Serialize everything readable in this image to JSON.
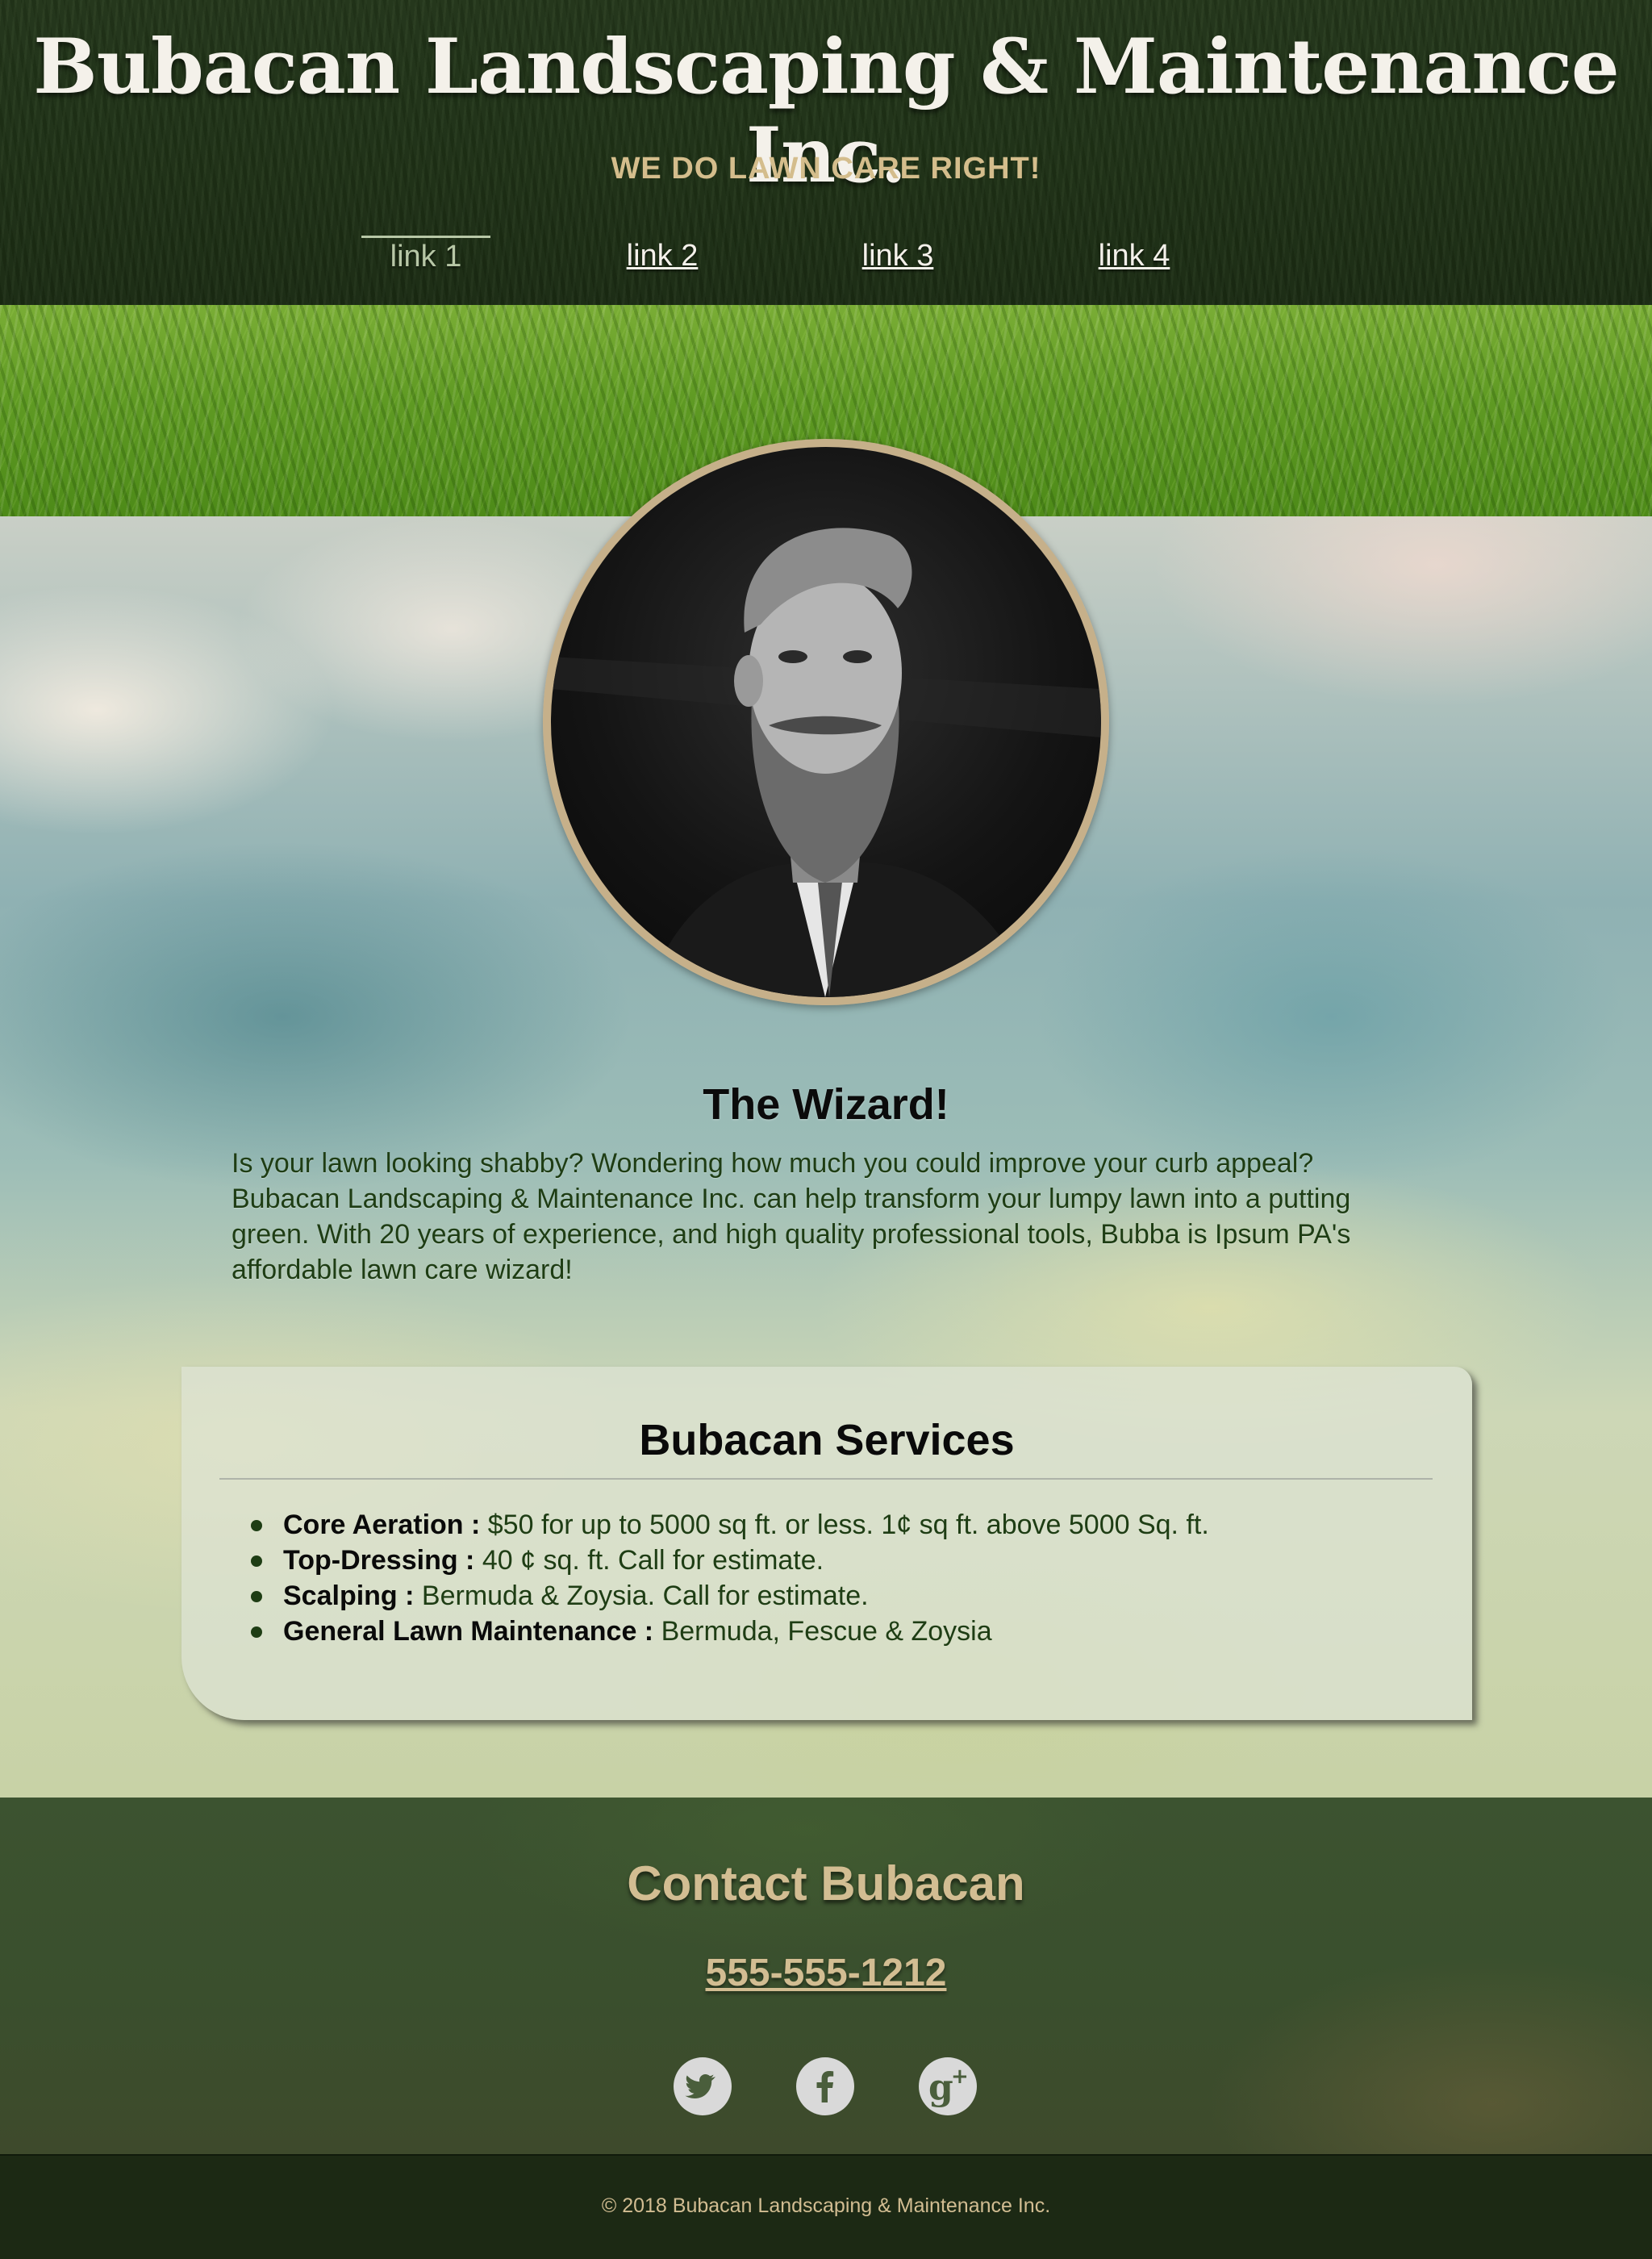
{
  "header": {
    "title": "Bubacan Landscaping & Maintenance Inc.",
    "tagline": "WE DO LAWN CARE RIGHT!",
    "nav": [
      {
        "label": "link 1",
        "active": true
      },
      {
        "label": "link 2",
        "active": false
      },
      {
        "label": "link 3",
        "active": false
      },
      {
        "label": "link 4",
        "active": false
      }
    ]
  },
  "wizard": {
    "heading": "The Wizard!",
    "text": "Is your lawn looking shabby? Wondering how much you could improve your curb appeal? Bubacan Landscaping & Maintenance Inc. can help transform your lumpy lawn into a putting green. With 20 years of experience, and high quality professional tools, Bubba is Ipsum PA's affordable lawn care wizard!"
  },
  "services": {
    "heading": "Bubacan Services",
    "items": [
      {
        "name": "Core Aeration :",
        "detail": " $50 for up to 5000 sq ft. or less. 1¢ sq ft. above 5000 Sq. ft."
      },
      {
        "name": "Top-Dressing :",
        "detail": " 40 ¢ sq. ft. Call for estimate."
      },
      {
        "name": "Scalping :",
        "detail": " Bermuda & Zoysia. Call for estimate."
      },
      {
        "name": "General Lawn Maintenance :",
        "detail": " Bermuda, Fescue & Zoysia"
      }
    ]
  },
  "contact": {
    "heading": "Contact Bubacan",
    "phone": "555-555-1212",
    "social": [
      {
        "icon": "twitter-icon"
      },
      {
        "icon": "facebook-icon"
      },
      {
        "icon": "google-plus-icon"
      }
    ]
  },
  "footer": {
    "copyright": "© 2018 Bubacan Landscaping & Maintenance Inc."
  },
  "colors": {
    "header_bg": "#1f3216",
    "accent_gold": "#d2bd92",
    "text_green": "#1e3d14",
    "footer_bg": "#1c2914"
  }
}
